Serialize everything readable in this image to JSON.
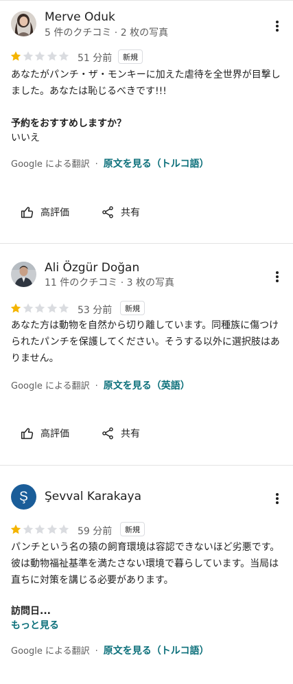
{
  "reviews": [
    {
      "name": "Merve Oduk",
      "meta": "5 件のクチコミ · 2 枚の写真",
      "rating": 1,
      "max_rating": 5,
      "time": "51 分前",
      "badge": "新規",
      "text": "あなたがパンチ・ザ・モンキーに加えた虐待を全世界が目撃しました。あなたは恥じるべきです!!!",
      "question": "予約をおすすめしますか？",
      "answer": "いいえ",
      "translated_by": "Google による翻訳",
      "see_original": "原文を見る（トルコ語）",
      "like_label": "高評価",
      "share_label": "共有"
    },
    {
      "name": "Ali Özgür Doğan",
      "meta": "11 件のクチコミ · 3 枚の写真",
      "rating": 1,
      "max_rating": 5,
      "time": "53 分前",
      "badge": "新規",
      "text": "あなた方は動物を自然から切り離しています。同種族に傷つけられたパンチを保護してください。そうする以外に選択肢はありません。",
      "translated_by": "Google による翻訳",
      "see_original": "原文を見る（英語）",
      "like_label": "高評価",
      "share_label": "共有"
    },
    {
      "name": "Şevval Karakaya",
      "avatar_letter": "Ş",
      "avatar_color": "#1a5d99",
      "rating": 1,
      "max_rating": 5,
      "time": "59 分前",
      "badge": "新規",
      "text": "パンチという名の猿の飼育環境は容認できないほど劣悪です。彼は動物福祉基準を満たさない環境で暮らしています。当局は直ちに対策を講じる必要があります。",
      "visit_label": "訪問日...",
      "more_label": "もっと見る",
      "translated_by": "Google による翻訳",
      "see_original": "原文を見る（トルコ語）"
    }
  ],
  "colors": {
    "star_filled": "#f4b400",
    "star_empty": "#dadce0",
    "link": "#0b6f7a"
  },
  "icons": {
    "more": "more-vert-icon",
    "like": "thumbs-up-icon",
    "share": "share-icon"
  }
}
